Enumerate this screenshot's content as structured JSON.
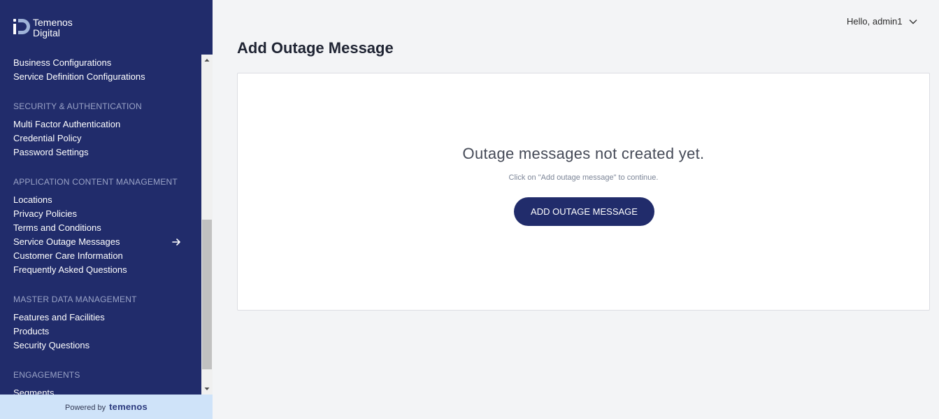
{
  "brand": {
    "logo_line1": "Temenos",
    "logo_line2": "Digital"
  },
  "sidebar": {
    "groups": [
      {
        "title": "",
        "items": [
          {
            "label": "Business Configurations"
          },
          {
            "label": "Service Definition Configurations"
          }
        ]
      },
      {
        "title": "SECURITY & AUTHENTICATION",
        "items": [
          {
            "label": "Multi Factor Authentication"
          },
          {
            "label": "Credential Policy"
          },
          {
            "label": "Password Settings"
          }
        ]
      },
      {
        "title": "APPLICATION CONTENT MANAGEMENT",
        "items": [
          {
            "label": "Locations"
          },
          {
            "label": "Privacy Policies"
          },
          {
            "label": "Terms and Conditions"
          },
          {
            "label": "Service Outage Messages",
            "active": true
          },
          {
            "label": "Customer Care Information"
          },
          {
            "label": "Frequently Asked Questions"
          }
        ]
      },
      {
        "title": "MASTER DATA MANAGEMENT",
        "items": [
          {
            "label": "Features and Facilities"
          },
          {
            "label": "Products"
          },
          {
            "label": "Security Questions"
          }
        ]
      },
      {
        "title": "ENGAGEMENTS",
        "items": [
          {
            "label": "Segments"
          }
        ]
      }
    ]
  },
  "footer": {
    "powered_by": "Powered by",
    "brand": "temenos"
  },
  "header": {
    "greeting": "Hello, admin1"
  },
  "page": {
    "title": "Add Outage Message"
  },
  "empty_state": {
    "title": "Outage messages not created yet.",
    "subtitle": "Click on \"Add outage message\" to continue.",
    "button_label": "ADD OUTAGE MESSAGE"
  },
  "colors": {
    "sidebar_bg": "#212c6b",
    "accent": "#212c6b",
    "footer_bg": "#cfe3f9",
    "page_bg": "#f3f4f6"
  }
}
